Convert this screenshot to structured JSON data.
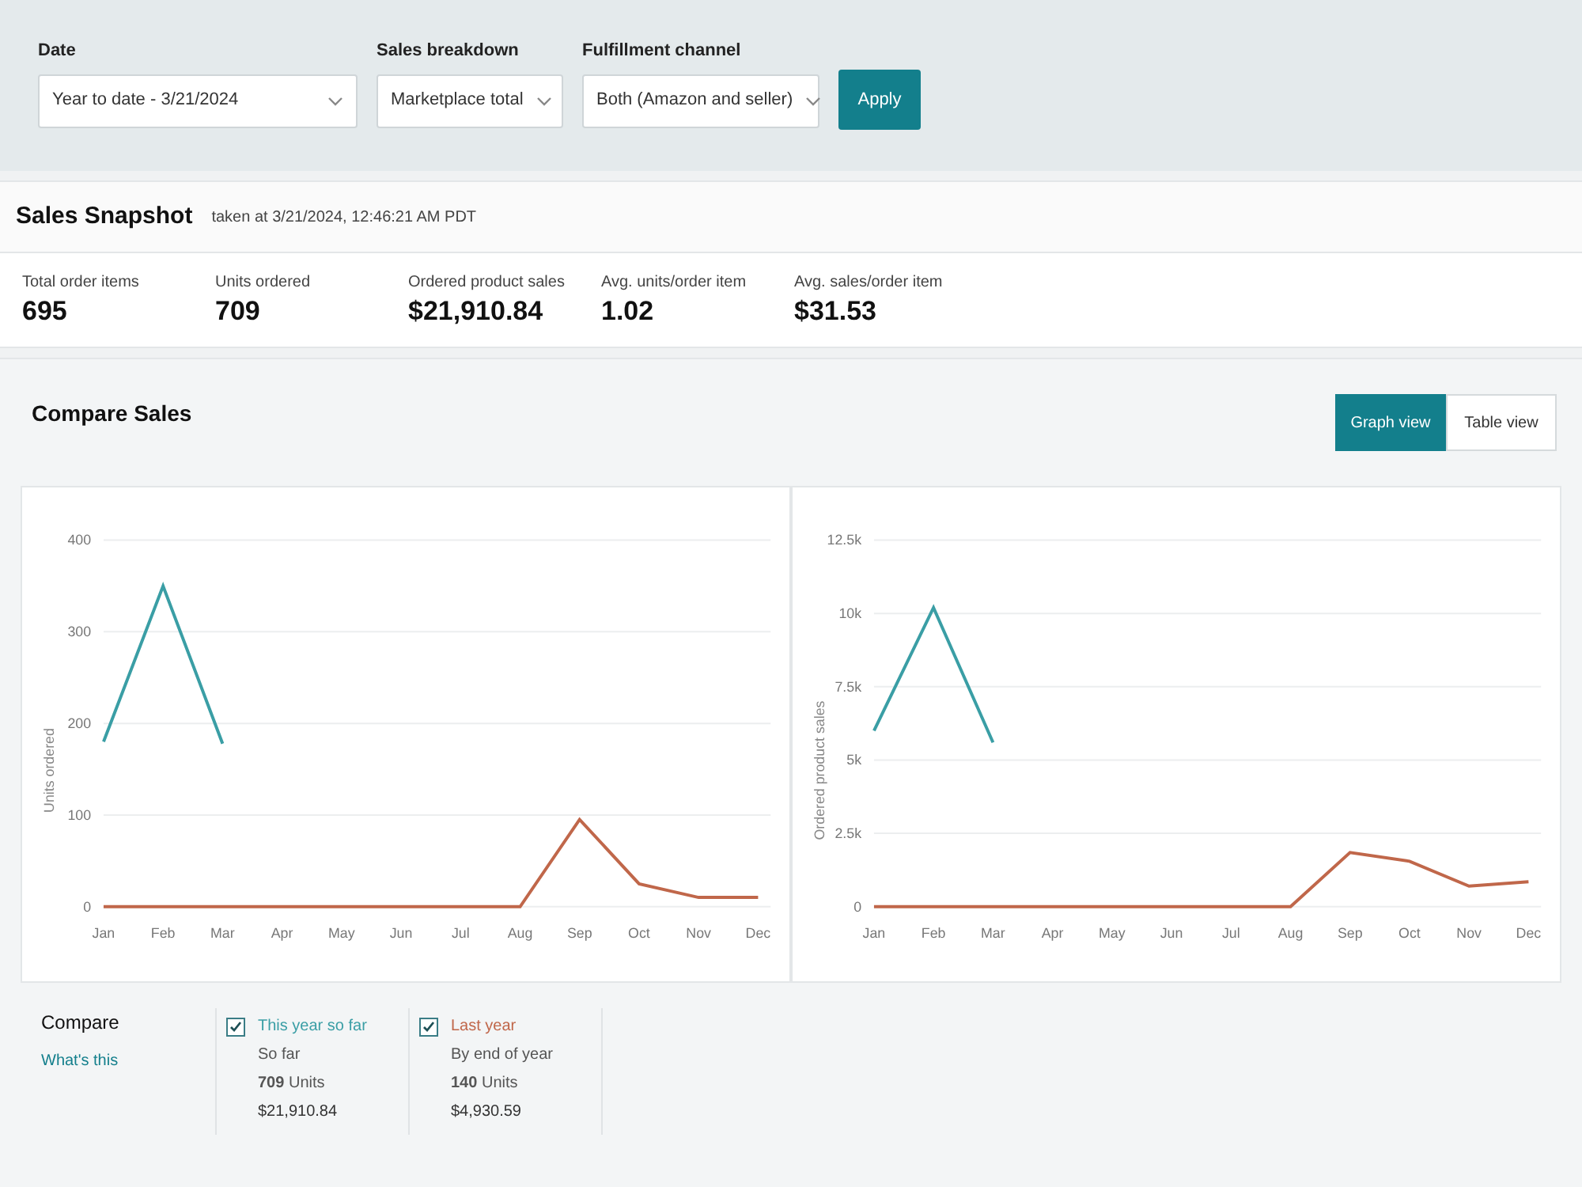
{
  "filters": [
    {
      "label": "Date",
      "value": "Year to date - 3/21/2024"
    },
    {
      "label": "Sales breakdown",
      "value": "Marketplace total"
    },
    {
      "label": "Fulfillment channel",
      "value": "Both (Amazon and seller)"
    }
  ],
  "apply_button": "Apply",
  "snapshot": {
    "title": "Sales Snapshot",
    "taken_at": "taken at 3/21/2024, 12:46:21 AM PDT",
    "metrics": [
      {
        "label": "Total order items",
        "value": "695"
      },
      {
        "label": "Units ordered",
        "value": "709"
      },
      {
        "label": "Ordered product sales",
        "value": "$21,910.84"
      },
      {
        "label": "Avg. units/order item",
        "value": "1.02"
      },
      {
        "label": "Avg. sales/order item",
        "value": "$31.53"
      }
    ]
  },
  "compare_sales": {
    "title": "Compare Sales",
    "views": [
      {
        "label": "Graph view",
        "selected": true
      },
      {
        "label": "Table view",
        "selected": false
      }
    ],
    "charts": [
      {
        "chart_data": {
          "type": "line",
          "ylabel": "Units ordered",
          "categories": [
            "Jan",
            "Feb",
            "Mar",
            "Apr",
            "May",
            "Jun",
            "Jul",
            "Aug",
            "Sep",
            "Oct",
            "Nov",
            "Dec"
          ],
          "grid": true,
          "ylim": [
            0,
            400
          ],
          "yticks": [
            0,
            100,
            200,
            300,
            400
          ],
          "series": [
            {
              "color": "#3a9ea5",
              "values": [
                180,
                350,
                178,
                null,
                null,
                null,
                null,
                null,
                null,
                null,
                null,
                null
              ]
            },
            {
              "color": "#c0674a",
              "values": [
                0,
                0,
                0,
                0,
                0,
                0,
                0,
                0,
                95,
                25,
                10,
                10
              ]
            }
          ]
        }
      },
      {
        "chart_data": {
          "type": "line",
          "ylabel": "Ordered product sales",
          "categories": [
            "Jan",
            "Feb",
            "Mar",
            "Apr",
            "May",
            "Jun",
            "Jul",
            "Aug",
            "Sep",
            "Oct",
            "Nov",
            "Dec"
          ],
          "grid": true,
          "ylim": [
            0,
            12500
          ],
          "yticks": [
            {
              "value": 0,
              "label": "0"
            },
            {
              "value": 2500,
              "label": "2.5k"
            },
            {
              "value": 5000,
              "label": "5k"
            },
            {
              "value": 7500,
              "label": "7.5k"
            },
            {
              "value": 10000,
              "label": "10k"
            },
            {
              "value": 12500,
              "label": "12.5k"
            }
          ],
          "series": [
            {
              "color": "#3a9ea5",
              "values": [
                6000,
                10200,
                5600,
                null,
                null,
                null,
                null,
                null,
                null,
                null,
                null,
                null
              ]
            },
            {
              "color": "#c0674a",
              "values": [
                0,
                0,
                0,
                0,
                0,
                0,
                0,
                0,
                1850,
                1550,
                700,
                850
              ]
            }
          ]
        }
      }
    ],
    "compare": {
      "title": "Compare",
      "link": "What's this",
      "items": [
        {
          "label": "This year so far",
          "color": "#3a9ea5",
          "checked": true,
          "period": "So far",
          "units": "**709** Units",
          "sales": "$21,910.84"
        },
        {
          "label": "Last year",
          "color": "#c0674a",
          "checked": true,
          "period": "By end of year",
          "units": "**140** Units",
          "sales": "$4,930.59"
        }
      ]
    }
  }
}
